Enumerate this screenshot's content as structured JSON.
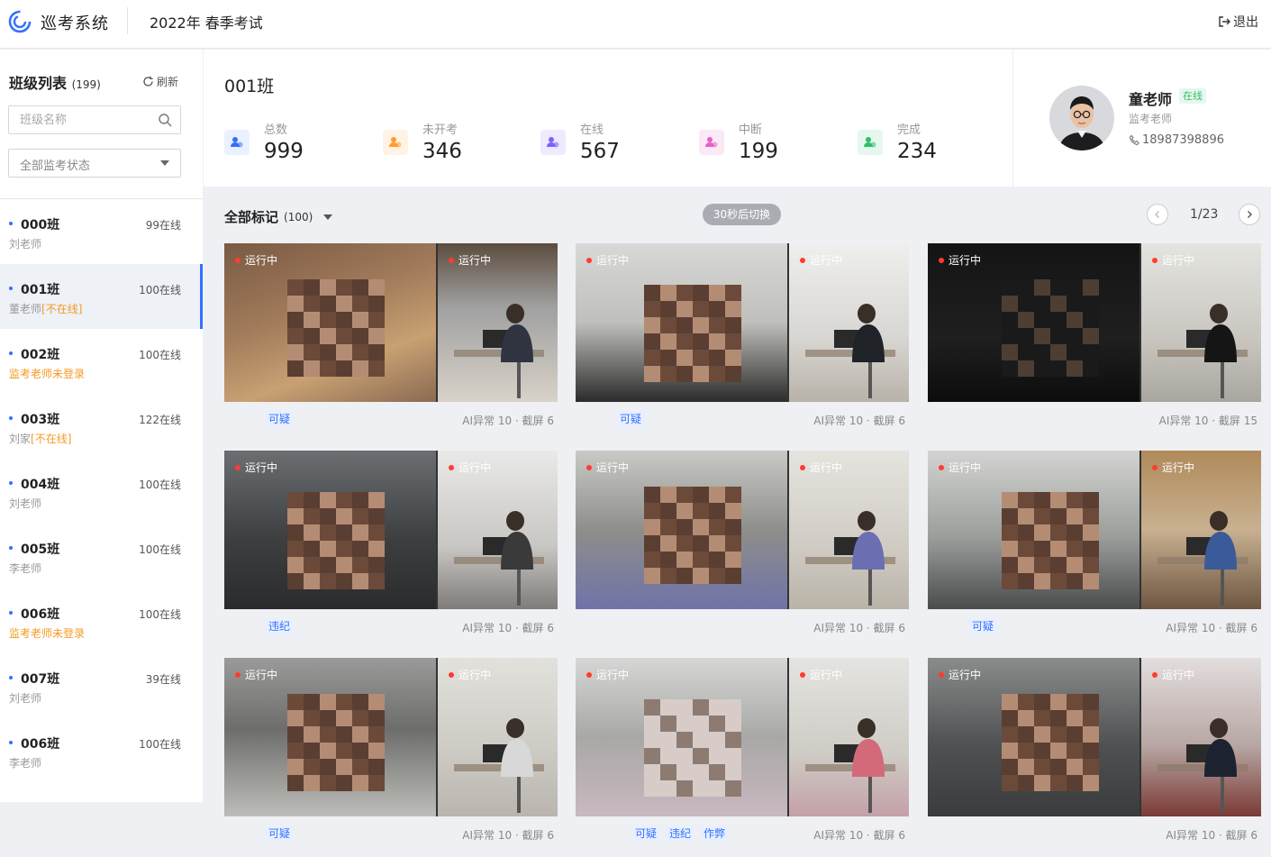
{
  "header": {
    "app_title": "巡考系统",
    "exam_title": "2022年 春季考试",
    "logout_label": "退出"
  },
  "sidebar": {
    "title": "班级列表",
    "count": "(199)",
    "refresh_label": "刷新",
    "search_placeholder": "班级名称",
    "status_filter": "全部监考状态",
    "classes": [
      {
        "name": "000班",
        "online": "99在线",
        "teacher": "刘老师",
        "status": ""
      },
      {
        "name": "001班",
        "online": "100在线",
        "teacher": "董老师",
        "status": "[不在线]"
      },
      {
        "name": "002班",
        "online": "100在线",
        "teacher": "",
        "status": "监考老师未登录"
      },
      {
        "name": "003班",
        "online": "122在线",
        "teacher": "刘家",
        "status": "[不在线]"
      },
      {
        "name": "004班",
        "online": "100在线",
        "teacher": "刘老师",
        "status": ""
      },
      {
        "name": "005班",
        "online": "100在线",
        "teacher": "李老师",
        "status": ""
      },
      {
        "name": "006班",
        "online": "100在线",
        "teacher": "",
        "status": "监考老师未登录"
      },
      {
        "name": "007班",
        "online": "39在线",
        "teacher": "刘老师",
        "status": ""
      },
      {
        "name": "006班",
        "online": "100在线",
        "teacher": "李老师",
        "status": ""
      }
    ]
  },
  "stats": {
    "class_title": "001班",
    "items": [
      {
        "label": "总数",
        "value": "999",
        "color": "#3370ff"
      },
      {
        "label": "未开考",
        "value": "346",
        "color": "#ff9a2e"
      },
      {
        "label": "在线",
        "value": "567",
        "color": "#7b61ff"
      },
      {
        "label": "中断",
        "value": "199",
        "color": "#e660c8"
      },
      {
        "label": "完成",
        "value": "234",
        "color": "#2fbf6b"
      }
    ]
  },
  "teacher": {
    "name": "童老师",
    "badge": "在线",
    "role": "监考老师",
    "phone": "18987398896"
  },
  "main": {
    "marks_title": "全部标记",
    "marks_count": "(100)",
    "switch_label": "30秒后切换",
    "page_text": "1/23",
    "running_label": "运行中",
    "cards": [
      {
        "tags": [
          "可疑"
        ],
        "ai": "AI异常 10",
        "shots": "截屏 6"
      },
      {
        "tags": [
          "可疑"
        ],
        "ai": "AI异常 10",
        "shots": "截屏 6"
      },
      {
        "tags": [],
        "ai": "AI异常 10",
        "shots": "截屏 15"
      },
      {
        "tags": [
          "违纪"
        ],
        "ai": "AI异常 10",
        "shots": "截屏 6"
      },
      {
        "tags": [],
        "ai": "AI异常 10",
        "shots": "截屏 6"
      },
      {
        "tags": [
          "可疑"
        ],
        "ai": "AI异常 10",
        "shots": "截屏 6"
      },
      {
        "tags": [
          "可疑"
        ],
        "ai": "AI异常 10",
        "shots": "截屏 6"
      },
      {
        "tags": [
          "可疑",
          "违纪",
          "作弊"
        ],
        "ai": "AI异常 10",
        "shots": "截屏 6"
      },
      {
        "tags": [],
        "ai": "AI异常 10",
        "shots": "截屏 6"
      }
    ]
  }
}
